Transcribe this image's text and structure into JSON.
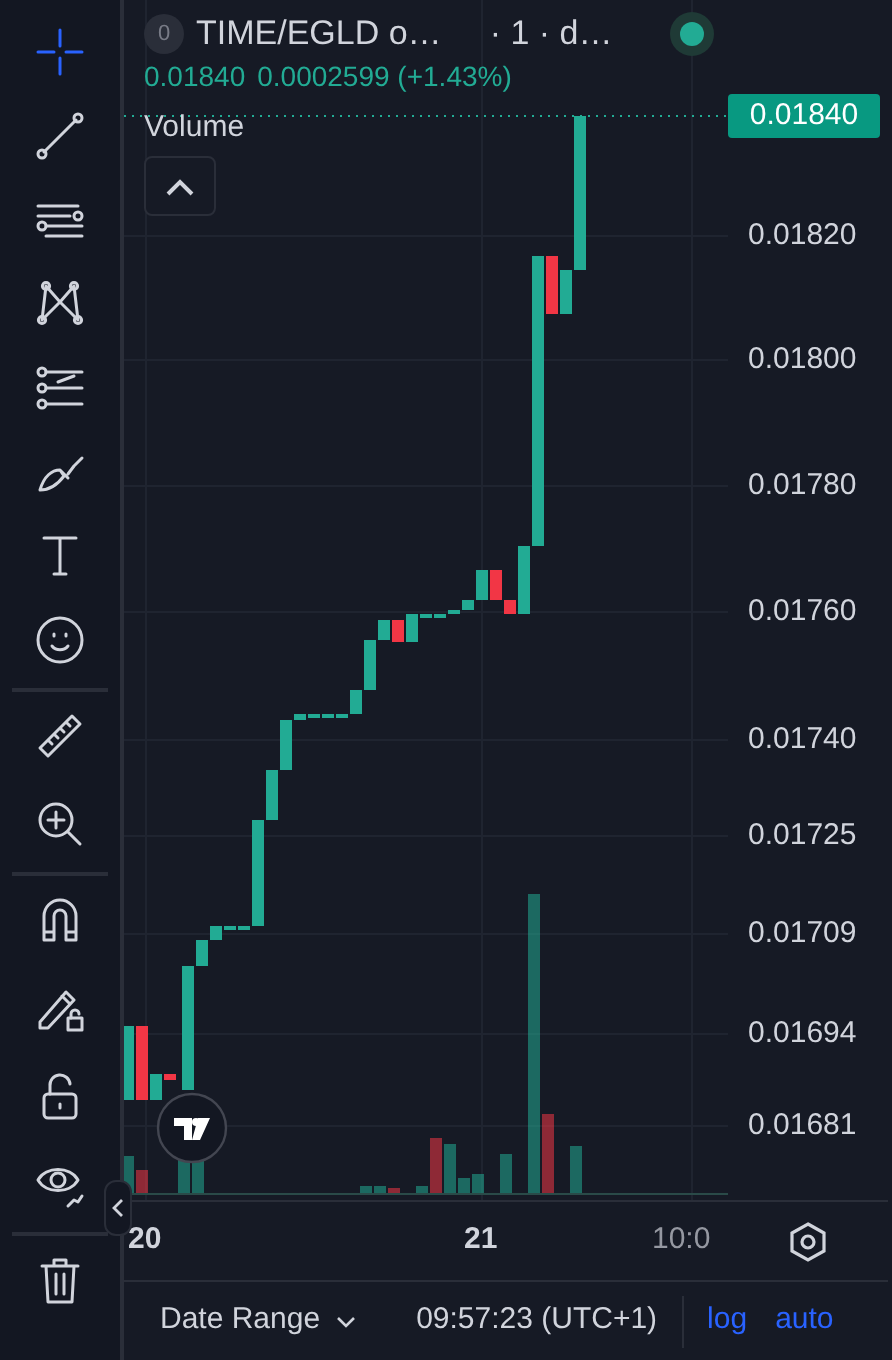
{
  "toolbar": {
    "groups": [
      {
        "tools": [
          {
            "selected": true
          },
          {
            "selected": false
          },
          {
            "selected": false
          },
          {
            "selected": false
          },
          {
            "selected": false
          },
          {
            "selected": false
          },
          {
            "selected": false
          },
          {
            "selected": false
          }
        ]
      },
      {
        "tools": [
          {
            "selected": false
          },
          {
            "selected": false
          }
        ]
      },
      {
        "tools": [
          {
            "selected": false
          },
          {
            "selected": false
          },
          {
            "selected": false
          },
          {
            "selected": false
          }
        ]
      },
      {
        "tools": [
          {
            "selected": false
          }
        ]
      }
    ]
  },
  "legend": {
    "badge": "0",
    "title": "TIME/EGLD o…",
    "interval": "· 1 · d…",
    "live": true,
    "price": "0.01840",
    "change": "0.0002599 (+1.43%)",
    "indicator": "Volume"
  },
  "price_axis": {
    "last_price": "0.01840",
    "labels": [
      "0.01820",
      "0.01800",
      "0.01780",
      "0.01760",
      "0.01740",
      "0.01725",
      "0.01709",
      "0.01694",
      "0.01681"
    ]
  },
  "time_axis": {
    "labels": [
      "20",
      "21",
      "10:0"
    ]
  },
  "bottom_bar": {
    "date_range": "Date Range",
    "clock": "09:57:23 (UTC+1)",
    "toggles": [
      {
        "label": "log",
        "on": true
      },
      {
        "label": "auto",
        "on": true
      }
    ]
  }
}
